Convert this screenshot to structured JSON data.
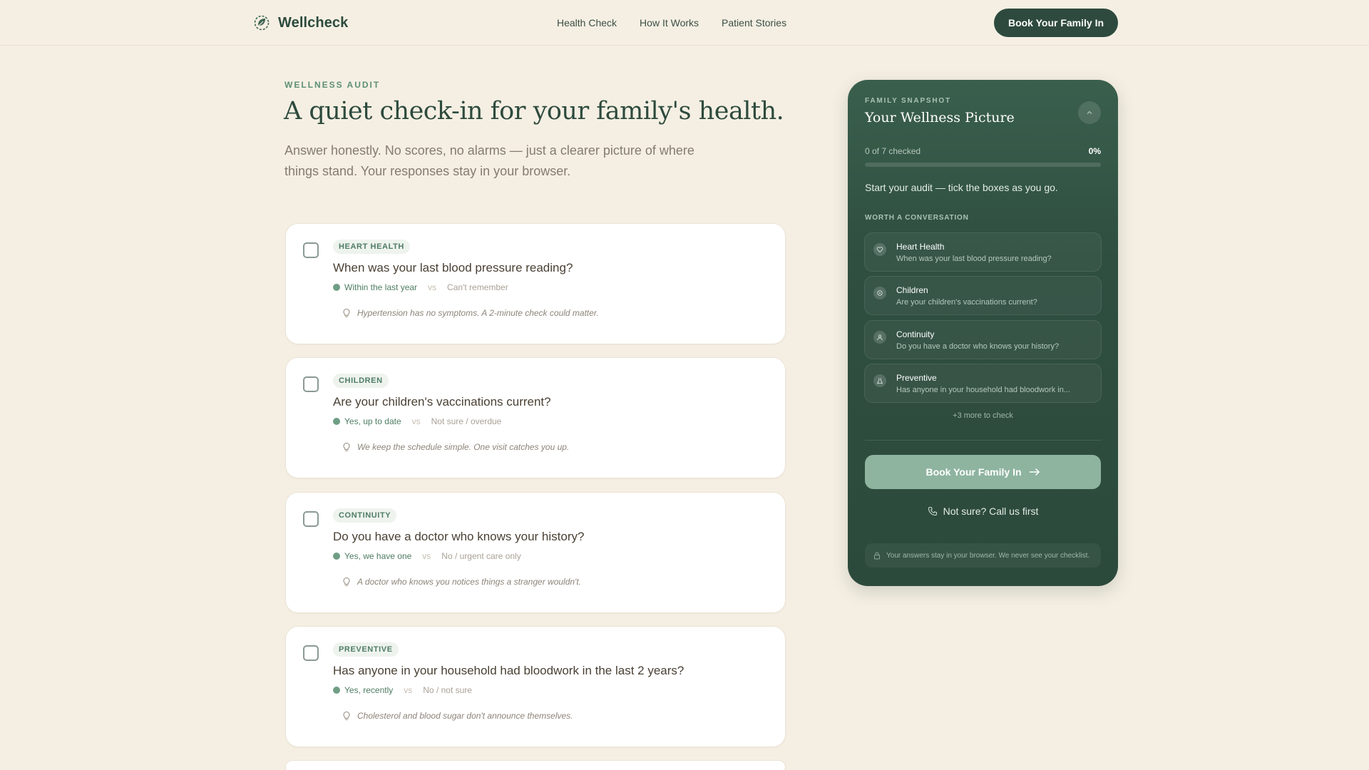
{
  "header": {
    "brand": "Wellcheck",
    "nav": [
      "Health Check",
      "How It Works",
      "Patient Stories"
    ],
    "cta": "Book Your Family In"
  },
  "intro": {
    "eyebrow": "WELLNESS AUDIT",
    "title": "A quiet check-in for your family's health.",
    "subtitle": "Answer honestly. No scores, no alarms — just a clearer picture of where things stand. Your responses stay in your browser."
  },
  "questions": [
    {
      "tag": "HEART HEALTH",
      "question": "When was your last blood pressure reading?",
      "yes": "Within the last year",
      "vs": "vs",
      "no": "Can't remember",
      "hint": "Hypertension has no symptoms. A 2-minute check could matter."
    },
    {
      "tag": "CHILDREN",
      "question": "Are your children's vaccinations current?",
      "yes": "Yes, up to date",
      "vs": "vs",
      "no": "Not sure / overdue",
      "hint": "We keep the schedule simple. One visit catches you up."
    },
    {
      "tag": "CONTINUITY",
      "question": "Do you have a doctor who knows your history?",
      "yes": "Yes, we have one",
      "vs": "vs",
      "no": "No / urgent care only",
      "hint": "A doctor who knows you notices things a stranger wouldn't."
    },
    {
      "tag": "PREVENTIVE",
      "question": "Has anyone in your household had bloodwork in the last 2 years?",
      "yes": "Yes, recently",
      "vs": "vs",
      "no": "No / not sure",
      "hint": "Cholesterol and blood sugar don't announce themselves."
    }
  ],
  "panel": {
    "eyebrow": "FAMILY SNAPSHOT",
    "title": "Your Wellness Picture",
    "progress_label": "0 of 7 checked",
    "progress_pct": "0%",
    "progress_fraction": 0,
    "status": "Start your audit — tick the boxes as you go.",
    "worth_label": "WORTH A CONVERSATION",
    "topics": [
      {
        "title": "Heart Health",
        "sub": "When was your last blood pressure reading?",
        "icon": "heart-icon"
      },
      {
        "title": "Children",
        "sub": "Are your children's vaccinations current?",
        "icon": "child-icon"
      },
      {
        "title": "Continuity",
        "sub": "Do you have a doctor who knows your history?",
        "icon": "person-icon"
      },
      {
        "title": "Preventive",
        "sub": "Has anyone in your household had bloodwork in...",
        "icon": "flask-icon"
      }
    ],
    "more": "+3 more to check",
    "cta": "Book Your Family In",
    "call": "Not sure? Call us first",
    "privacy": "Your answers stay in your browser. We never see your checklist."
  },
  "colors": {
    "background": "#f5efe3",
    "brand_dark": "#2e4a3e",
    "accent": "#5e8f76",
    "panel": "#2f4f40"
  }
}
